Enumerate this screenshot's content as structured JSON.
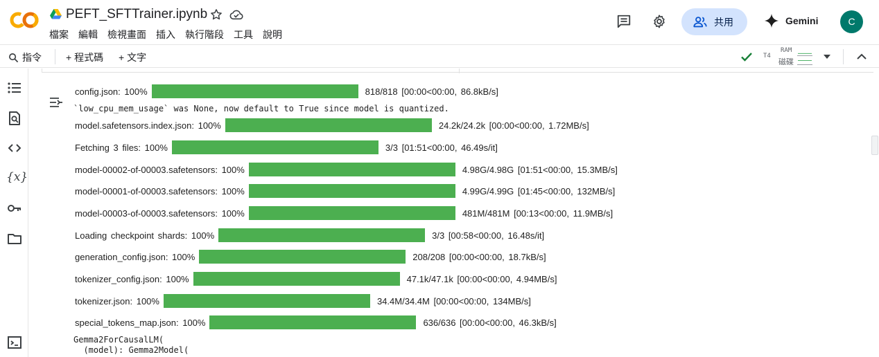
{
  "header": {
    "title": "PEFT_SFTTrainer.ipynb",
    "menu": [
      "檔案",
      "編輯",
      "檢視畫面",
      "插入",
      "執行階段",
      "工具",
      "說明"
    ],
    "share_label": "共用",
    "gemini_label": "Gemini",
    "avatar_initial": "C"
  },
  "toolbar": {
    "command_label": "指令",
    "add_code_label": "+ 程式碼",
    "add_text_label": "+ 文字",
    "gpu_label": "T4",
    "ram_label": "RAM",
    "disk_label": "磁碟"
  },
  "output": {
    "warning_line": "`low_cpu_mem_usage` was None, now default to True since model is quantized.",
    "progress": [
      {
        "label": "config.json: 100%",
        "fraction": 1.0,
        "stats": "818/818 [00:00<00:00, 86.8kB/s]"
      },
      {
        "label": "model.safetensors.index.json: 100%",
        "fraction": 1.0,
        "stats": "24.2k/24.2k [00:00<00:00, 1.72MB/s]"
      },
      {
        "label": "Fetching 3 files: 100%",
        "fraction": 1.0,
        "stats": "3/3 [01:51<00:00, 46.49s/it]"
      },
      {
        "label": "model-00002-of-00003.safetensors: 100%",
        "fraction": 1.0,
        "stats": "4.98G/4.98G [01:51<00:00, 15.3MB/s]"
      },
      {
        "label": "model-00001-of-00003.safetensors: 100%",
        "fraction": 1.0,
        "stats": "4.99G/4.99G [01:45<00:00, 132MB/s]"
      },
      {
        "label": "model-00003-of-00003.safetensors: 100%",
        "fraction": 1.0,
        "stats": "481M/481M [00:13<00:00, 11.9MB/s]"
      },
      {
        "label": "Loading checkpoint shards: 100%",
        "fraction": 1.0,
        "stats": "3/3 [00:58<00:00, 16.48s/it]"
      },
      {
        "label": "generation_config.json: 100%",
        "fraction": 1.0,
        "stats": "208/208 [00:00<00:00, 18.7kB/s]"
      },
      {
        "label": "tokenizer_config.json: 100%",
        "fraction": 1.0,
        "stats": "47.1k/47.1k [00:00<00:00, 4.94MB/s]"
      },
      {
        "label": "tokenizer.json: 100%",
        "fraction": 1.0,
        "stats": "34.4M/34.4M [00:00<00:00, 134MB/s]"
      },
      {
        "label": "special_tokens_map.json: 100%",
        "fraction": 1.0,
        "stats": "636/636 [00:00<00:00, 46.3kB/s]"
      }
    ],
    "model_lines": [
      "Gemma2ForCausalLM(",
      "  (model): Gemma2Model("
    ]
  },
  "colors": {
    "progress_fill": "#4caf50",
    "share_bg": "#d3e3fd",
    "avatar_bg": "#00796b",
    "logo_orange": "#f9ab00",
    "logo_dark_orange": "#e8710a",
    "check_green": "#188038"
  },
  "icons": {
    "rail": [
      "toc-icon",
      "find-icon",
      "code-snippets-icon",
      "variables-icon",
      "secrets-key-icon",
      "files-folder-icon",
      "terminal-icon"
    ]
  }
}
